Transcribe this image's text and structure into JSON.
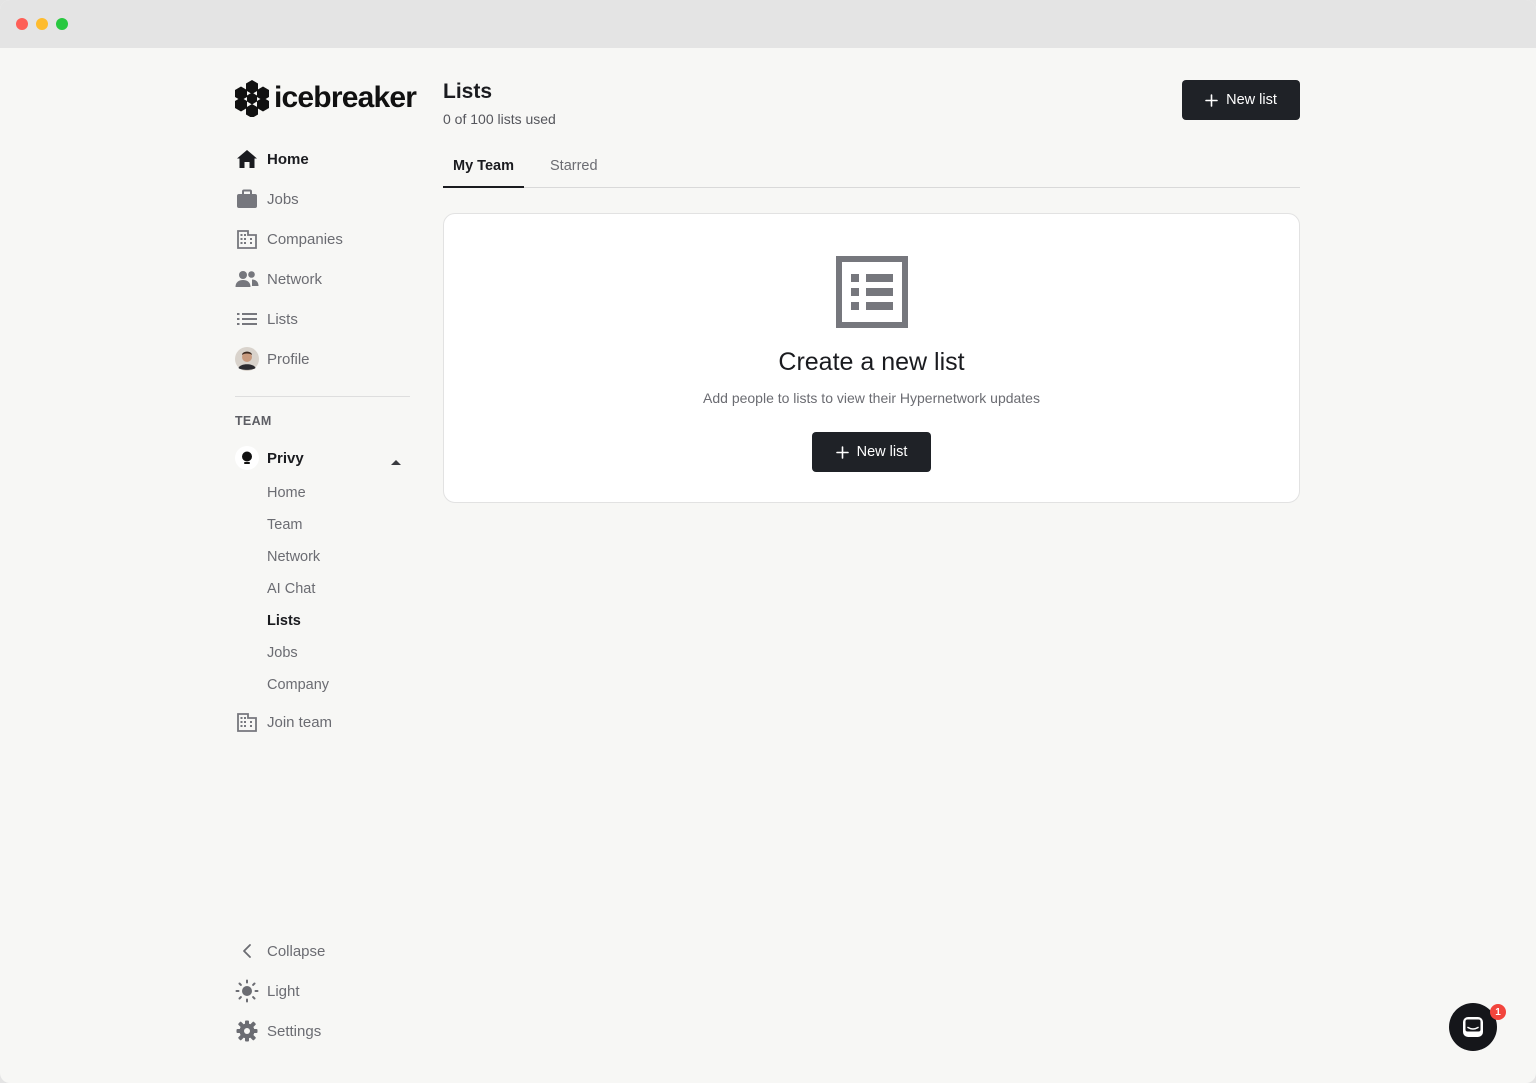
{
  "window": {
    "accent": "#1f2227"
  },
  "brand": {
    "name": "icebreaker"
  },
  "sidebar": {
    "items": [
      {
        "label": "Home",
        "icon": "home-icon"
      },
      {
        "label": "Jobs",
        "icon": "briefcase-icon"
      },
      {
        "label": "Companies",
        "icon": "building-icon"
      },
      {
        "label": "Network",
        "icon": "people-icon"
      },
      {
        "label": "Lists",
        "icon": "list-icon"
      },
      {
        "label": "Profile",
        "icon": "avatar"
      }
    ],
    "team_section_label": "TEAM",
    "team": {
      "name": "Privy",
      "items": [
        "Home",
        "Team",
        "Network",
        "AI Chat",
        "Lists",
        "Jobs",
        "Company"
      ]
    },
    "join_team": "Join team",
    "bottom": {
      "collapse": "Collapse",
      "theme": "Light",
      "settings": "Settings"
    }
  },
  "main": {
    "title": "Lists",
    "subtitle": "0 of 100 lists used",
    "new_list_label": "New list",
    "tabs": [
      "My Team",
      "Starred"
    ],
    "empty_state": {
      "title": "Create a new list",
      "description": "Add people to lists to view their Hypernetwork updates",
      "button_label": "New list"
    }
  },
  "chat": {
    "badge_count": "1"
  }
}
